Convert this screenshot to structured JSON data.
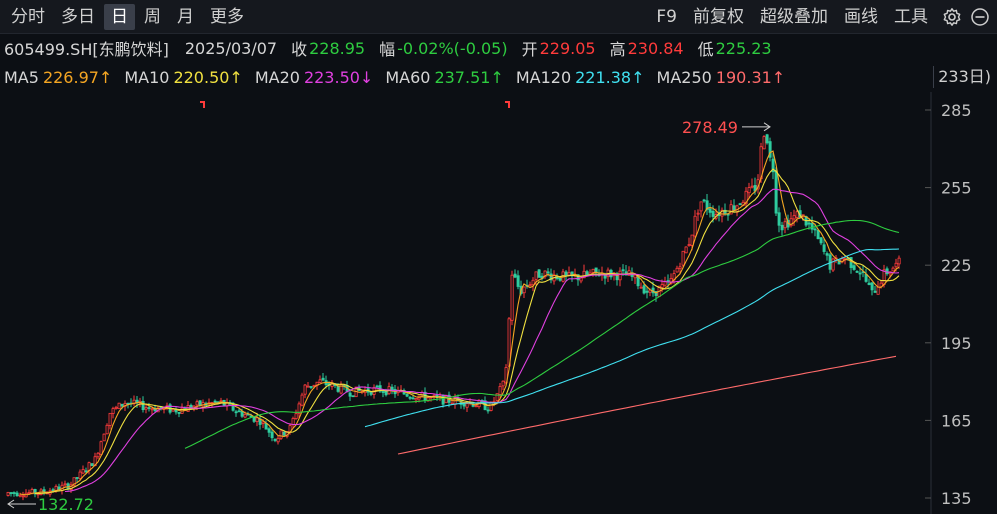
{
  "toolbar": {
    "left": [
      {
        "name": "tab-intraday",
        "label": "分时",
        "active": false
      },
      {
        "name": "tab-multi-day",
        "label": "多日",
        "active": false
      },
      {
        "name": "tab-daily",
        "label": "日",
        "active": true
      },
      {
        "name": "tab-weekly",
        "label": "周",
        "active": false
      },
      {
        "name": "tab-monthly",
        "label": "月",
        "active": false
      },
      {
        "name": "tab-more",
        "label": "更多",
        "active": false
      }
    ],
    "right": [
      {
        "name": "f9-button",
        "label": "F9"
      },
      {
        "name": "forward-adjust-button",
        "label": "前复权"
      },
      {
        "name": "overlay-button",
        "label": "超级叠加"
      },
      {
        "name": "draw-line-button",
        "label": "画线"
      },
      {
        "name": "tools-button",
        "label": "工具"
      }
    ],
    "icons": [
      "settings-icon",
      "minimize-icon"
    ]
  },
  "quote": {
    "code": "605499.SH[东鹏饮料]",
    "date": "2025/03/07",
    "close_label": "收",
    "close": "228.95",
    "change_label": "幅",
    "change": "-0.02%(-0.05)",
    "open_label": "开",
    "open": "229.05",
    "high_label": "高",
    "high": "230.84",
    "low_label": "低",
    "low": "225.23"
  },
  "ma": {
    "items": [
      {
        "label": "MA5",
        "value": "226.97↑",
        "color": "#f5a623"
      },
      {
        "label": "MA10",
        "value": "220.50↑",
        "color": "#f0e040"
      },
      {
        "label": "MA20",
        "value": "223.50↓",
        "color": "#e040e0"
      },
      {
        "label": "MA60",
        "value": "237.51↑",
        "color": "#2ecc40"
      },
      {
        "label": "MA120",
        "value": "221.38↑",
        "color": "#40e0f0"
      },
      {
        "label": "MA250",
        "value": "190.31↑",
        "color": "#ff6b6b"
      }
    ],
    "more": "233日)"
  },
  "chart_data": {
    "type": "candlestick",
    "y_ticks": [
      "285",
      "255",
      "225",
      "195",
      "165",
      "135"
    ],
    "ylim": [
      135,
      285
    ],
    "annotations": [
      {
        "text": "278.49",
        "value": 278.49,
        "kind": "high"
      },
      {
        "text": "132.72",
        "value": 132.72,
        "kind": "low"
      }
    ],
    "colors": {
      "up": "#ff3b3b",
      "down": "#2ecc9e",
      "grid": "#1c2028"
    }
  }
}
